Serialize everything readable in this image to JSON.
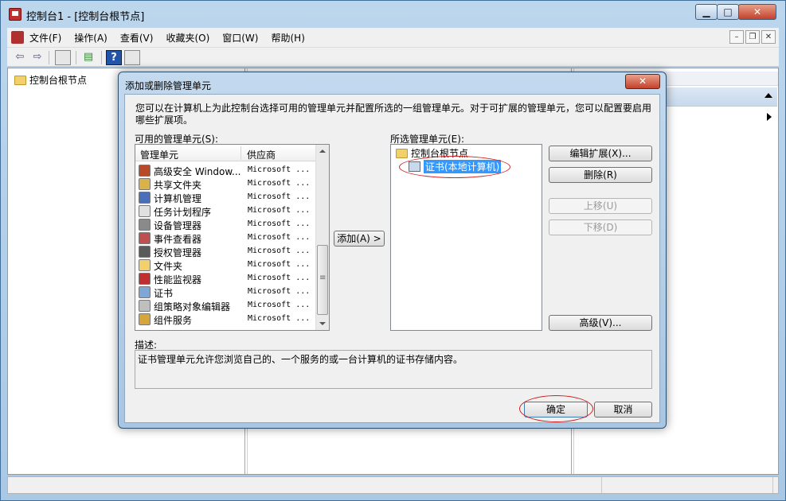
{
  "window": {
    "title": "控制台1 - [控制台根节点]",
    "controls": {
      "minimize": "▁",
      "maximize": "□",
      "close": "✕"
    }
  },
  "menubar": {
    "items": [
      "文件(F)",
      "操作(A)",
      "查看(V)",
      "收藏夹(O)",
      "窗口(W)",
      "帮助(H)"
    ],
    "mdi": {
      "minimize": "–",
      "restore": "❐",
      "close": "✕"
    }
  },
  "toolbar": {
    "back": "⇦",
    "forward": "⇨",
    "help": "?"
  },
  "tree": {
    "root": "控制台根节点"
  },
  "dialog": {
    "title": "添加或删除管理单元",
    "close": "✕",
    "intro": "您可以在计算机上为此控制台选择可用的管理单元并配置所选的一组管理单元。对于可扩展的管理单元，您可以配置要启用哪些扩展项。",
    "available_label": "可用的管理单元(S):",
    "selected_label": "所选管理单元(E):",
    "columns": [
      "管理单元",
      "供应商"
    ],
    "snapins": [
      {
        "name": "高级安全 Window...",
        "vendor": "Microsoft ...",
        "icon": "firewall-icon",
        "color": "#b84a2a"
      },
      {
        "name": "共享文件夹",
        "vendor": "Microsoft ...",
        "icon": "shared-folder-icon",
        "color": "#d9b34a"
      },
      {
        "name": "计算机管理",
        "vendor": "Microsoft ...",
        "icon": "computer-management-icon",
        "color": "#4a6fb8"
      },
      {
        "name": "任务计划程序",
        "vendor": "Microsoft ...",
        "icon": "clock-icon",
        "color": "#e0e0e0"
      },
      {
        "name": "设备管理器",
        "vendor": "Microsoft ...",
        "icon": "device-manager-icon",
        "color": "#8a8a8a"
      },
      {
        "name": "事件查看器",
        "vendor": "Microsoft ...",
        "icon": "event-viewer-icon",
        "color": "#c05050"
      },
      {
        "name": "授权管理器",
        "vendor": "Microsoft ...",
        "icon": "authorization-icon",
        "color": "#5a5a5a"
      },
      {
        "name": "文件夹",
        "vendor": "Microsoft ...",
        "icon": "folder-icon",
        "color": "#f2d06b"
      },
      {
        "name": "性能监视器",
        "vendor": "Microsoft ...",
        "icon": "performance-monitor-icon",
        "color": "#c03030"
      },
      {
        "name": "证书",
        "vendor": "Microsoft ...",
        "icon": "certificate-icon",
        "color": "#7ea6d6"
      },
      {
        "name": "组策略对象编辑器",
        "vendor": "Microsoft ...",
        "icon": "group-policy-icon",
        "color": "#bfbfbf"
      },
      {
        "name": "组件服务",
        "vendor": "Microsoft ...",
        "icon": "component-services-icon",
        "color": "#d6a63a"
      }
    ],
    "add_button": "添加(A) >",
    "selected_root": "控制台根节点",
    "selected_child": "证书(本地计算机)",
    "buttons": {
      "edit_extensions": "编辑扩展(X)...",
      "remove": "删除(R)",
      "move_up": "上移(U)",
      "move_down": "下移(D)",
      "advanced": "高级(V)..."
    },
    "description_label": "描述:",
    "description": "证书管理单元允许您浏览自己的、一个服务的或一台计算机的证书存储内容。",
    "ok": "确定",
    "cancel": "取消"
  }
}
